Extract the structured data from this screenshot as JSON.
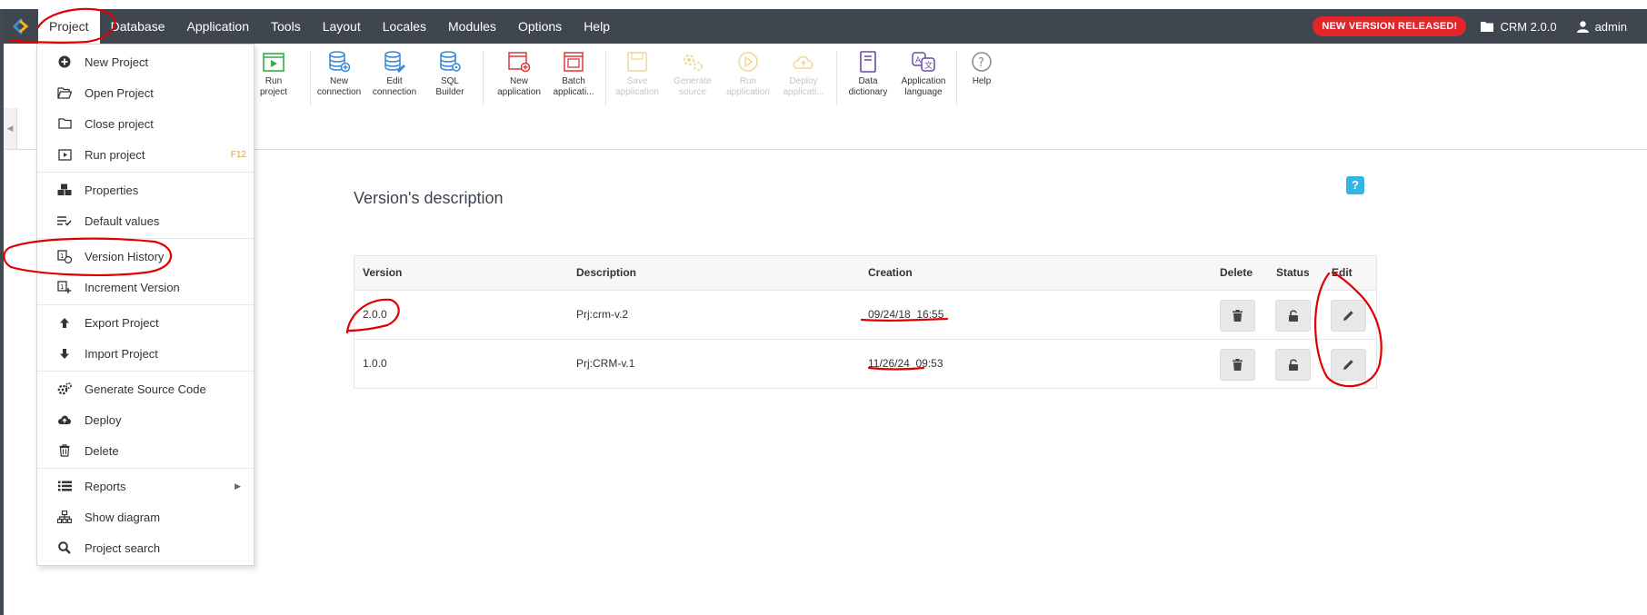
{
  "menubar": {
    "items": [
      {
        "label": "Project",
        "active": true
      },
      {
        "label": "Database"
      },
      {
        "label": "Application"
      },
      {
        "label": "Tools"
      },
      {
        "label": "Layout"
      },
      {
        "label": "Locales"
      },
      {
        "label": "Modules"
      },
      {
        "label": "Options"
      },
      {
        "label": "Help"
      }
    ],
    "new_version": "NEW VERSION RELEASED!",
    "project": "CRM 2.0.0",
    "user": "admin"
  },
  "toolbar": {
    "run_project": "Run\nproject",
    "new_connection": "New\nconnection",
    "edit_connection": "Edit\nconnection",
    "sql_builder": "SQL\nBuilder",
    "new_application": "New\napplication",
    "batch_application": "Batch\napplicati...",
    "save_application": "Save\napplication",
    "generate_source": "Generate\nsource",
    "run_application": "Run\napplication",
    "deploy_application": "Deploy\napplicati...",
    "data_dictionary": "Data\ndictionary",
    "application_language": "Application\nlanguage",
    "help": "Help"
  },
  "dropdown": {
    "items": [
      {
        "label": "New Project",
        "icon": "plus-circle-icon"
      },
      {
        "label": "Open Project",
        "icon": "folder-open-icon"
      },
      {
        "label": "Close project",
        "icon": "folder-icon"
      },
      {
        "label": "Run project",
        "icon": "run-icon",
        "shortcut": "F12"
      },
      {
        "label": "Properties",
        "icon": "cubes-icon"
      },
      {
        "label": "Default values",
        "icon": "list-check-icon"
      },
      {
        "label": "Version History",
        "icon": "history-icon"
      },
      {
        "label": "Increment Version",
        "icon": "increment-icon"
      },
      {
        "label": "Export Project",
        "icon": "arrow-up-icon"
      },
      {
        "label": "Import Project",
        "icon": "arrow-down-icon"
      },
      {
        "label": "Generate Source Code",
        "icon": "gears-icon"
      },
      {
        "label": "Deploy",
        "icon": "cloud-upload-icon"
      },
      {
        "label": "Delete",
        "icon": "trash-icon"
      },
      {
        "label": "Reports",
        "icon": "list-icon",
        "submenu": true
      },
      {
        "label": "Show diagram",
        "icon": "sitemap-icon"
      },
      {
        "label": "Project search",
        "icon": "search-icon"
      }
    ]
  },
  "content": {
    "title": "Version's description",
    "help_badge": "?",
    "table": {
      "headers": [
        "Version",
        "Description",
        "Creation",
        "Delete",
        "Status",
        "Edit"
      ],
      "rows": [
        {
          "version": "2.0.0",
          "description": "Prj:crm-v.2",
          "creation": "09/24/18  16:55"
        },
        {
          "version": "1.0.0",
          "description": "Prj:CRM-v.1",
          "creation": "11/26/24  09:53"
        }
      ]
    }
  },
  "colors": {
    "menubar_bg": "#3f4650",
    "new_version_bg": "#e1262a",
    "help_badge_bg": "#33b5e5",
    "annotation": "#e00000"
  }
}
